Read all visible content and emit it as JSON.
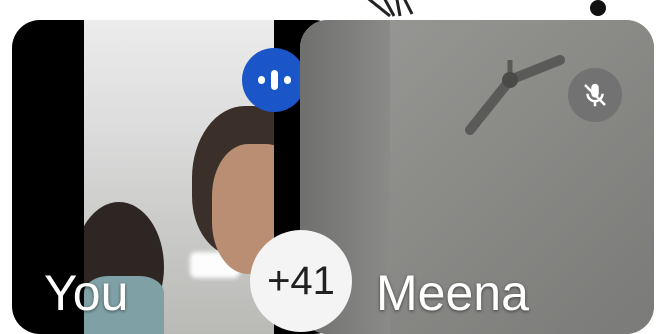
{
  "participants": [
    {
      "name": "You",
      "status": "speaking",
      "badge_color": "#1a56c8"
    },
    {
      "name": "Meena",
      "status": "muted"
    }
  ],
  "more_participants_label": "+41",
  "icons": {
    "speaking": "audio-level-icon",
    "muted": "mic-off-icon",
    "menu": "more-options-icon"
  }
}
